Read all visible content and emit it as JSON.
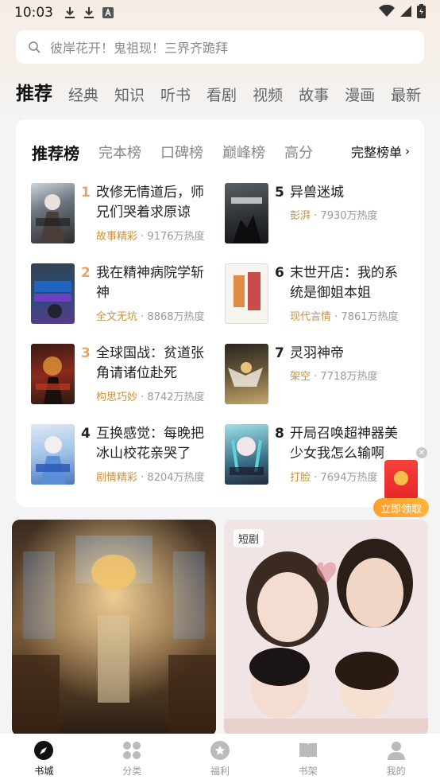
{
  "status_bar": {
    "time": "10:03"
  },
  "search": {
    "placeholder": "彼岸花开！鬼祖现！三界齐跪拜"
  },
  "tabs": [
    "推荐",
    "经典",
    "知识",
    "听书",
    "看剧",
    "视频",
    "故事",
    "漫画",
    "最新"
  ],
  "ranking": {
    "tabs": [
      "推荐榜",
      "完本榜",
      "口碑榜",
      "巅峰榜",
      "高分"
    ],
    "full_list": "完整榜单",
    "books": [
      {
        "rank": "1",
        "title": "改修无情道后，师兄们哭着求原谅",
        "tag": "故事精彩",
        "heat": "9176万热度"
      },
      {
        "rank": "2",
        "title": "我在精神病院学斩神",
        "tag": "全文无坑",
        "heat": "8868万热度"
      },
      {
        "rank": "3",
        "title": "全球国战：贫道张角请诸位赴死",
        "tag": "构思巧妙",
        "heat": "8742万热度"
      },
      {
        "rank": "4",
        "title": "互换感觉：每晚把冰山校花亲哭了",
        "tag": "剧情精彩",
        "heat": "8204万热度"
      },
      {
        "rank": "5",
        "title": "异兽迷城",
        "tag": "彭湃",
        "heat": "7930万热度"
      },
      {
        "rank": "6",
        "title": "末世开店：我的系统是御姐本姐",
        "tag": "现代言情",
        "heat": "7861万热度"
      },
      {
        "rank": "7",
        "title": "灵羽神帝",
        "tag": "架空",
        "heat": "7718万热度"
      },
      {
        "rank": "8",
        "title": "开局召唤超神器美少女我怎么输啊",
        "tag": "打脸",
        "heat": "7694万热度"
      }
    ]
  },
  "promo": {
    "claim_label": "立即领取"
  },
  "feed": {
    "drama_tag": "短剧"
  },
  "bottom_nav": [
    "书城",
    "分类",
    "福利",
    "书架",
    "我的"
  ],
  "colors": {
    "accent_gold": "#c8913d",
    "rank_gold": "#e0a66a",
    "rank_dark": "#222222"
  }
}
